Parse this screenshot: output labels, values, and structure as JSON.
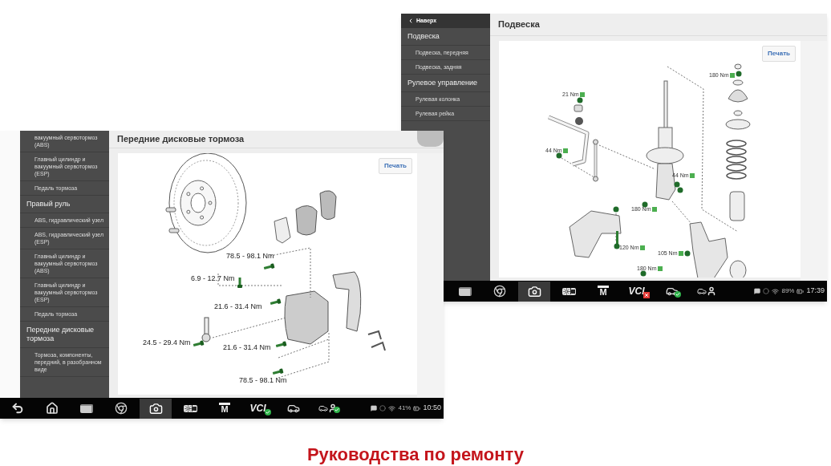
{
  "screens": [
    {
      "sidebar": {
        "header": "Наверх",
        "items": [
          {
            "kind": "group",
            "label": "Подвеска"
          },
          {
            "kind": "item",
            "label": "Подвеска, передняя"
          },
          {
            "kind": "item",
            "label": "Подвеска, задняя"
          },
          {
            "kind": "group",
            "label": "Рулевое управление"
          },
          {
            "kind": "item",
            "label": "Рулевая колонка"
          },
          {
            "kind": "item",
            "label": "Рулевая рейка"
          }
        ]
      },
      "title": "Подвеска",
      "print_button": "Печать",
      "diagram": {
        "kind": "suspension",
        "labels": [
          "180 Nm",
          "21 Nm",
          "44 Nm",
          "44 Nm",
          "180 Nm",
          "120 Nm",
          "105 Nm",
          "180 Nm"
        ]
      },
      "taskbar": {
        "items": [
          {
            "kind": "recents",
            "selected": false,
            "checked": false,
            "error": false
          },
          {
            "kind": "browser",
            "selected": false,
            "checked": false,
            "error": false
          },
          {
            "kind": "camera",
            "selected": true,
            "checked": false,
            "error": false
          },
          {
            "kind": "display",
            "selected": false,
            "checked": false,
            "error": false
          },
          {
            "kind": "manual",
            "text": "M",
            "selected": false,
            "checked": false,
            "error": false
          },
          {
            "kind": "vci",
            "text": "VCI",
            "selected": false,
            "checked": false,
            "error": true
          },
          {
            "kind": "car",
            "selected": false,
            "checked": true,
            "error": false
          },
          {
            "kind": "person",
            "selected": false,
            "checked": false,
            "error": false
          }
        ],
        "battery": "89%",
        "time": "17:39"
      }
    },
    {
      "sidebar": {
        "items": [
          {
            "kind": "item",
            "label": "вакуумный сервотормоз (ABS)"
          },
          {
            "kind": "item",
            "label": "Главный цилиндр и вакуумный сервотормоз (ESP)"
          },
          {
            "kind": "item",
            "label": "Педаль тормоза"
          },
          {
            "kind": "group",
            "label": "Правый руль"
          },
          {
            "kind": "item",
            "label": "ABS, гидравлический узел"
          },
          {
            "kind": "item",
            "label": "ABS, гидравлический узел (ESP)"
          },
          {
            "kind": "item",
            "label": "Главный цилиндр и вакуумный сервотормоз (ABS)"
          },
          {
            "kind": "item",
            "label": "Главный цилиндр и вакуумный сервотормоз (ESP)"
          },
          {
            "kind": "item",
            "label": "Педаль тормоза"
          },
          {
            "kind": "group",
            "label": "Передние дисковые тормоза"
          },
          {
            "kind": "item",
            "label": "Тормоза, компоненты, передний, в разобранном виде"
          }
        ]
      },
      "title": "Передние дисковые тормоза",
      "print_button": "Печать",
      "diagram": {
        "kind": "brakes",
        "labels": [
          "78.5 - 98.1 Nm",
          "6.9 - 12.7 Nm",
          "21.6 - 31.4 Nm",
          "24.5 - 29.4 Nm",
          "21.6 - 31.4 Nm",
          "78.5 - 98.1 Nm"
        ]
      },
      "taskbar": {
        "items": [
          {
            "kind": "back",
            "selected": false,
            "checked": false,
            "error": false
          },
          {
            "kind": "home",
            "selected": false,
            "checked": false,
            "error": false
          },
          {
            "kind": "recents",
            "selected": false,
            "checked": false,
            "error": false
          },
          {
            "kind": "browser",
            "selected": false,
            "checked": false,
            "error": false
          },
          {
            "kind": "camera",
            "selected": true,
            "checked": false,
            "error": false
          },
          {
            "kind": "display",
            "selected": false,
            "checked": false,
            "error": false
          },
          {
            "kind": "manual",
            "text": "M",
            "selected": false,
            "checked": false,
            "error": false
          },
          {
            "kind": "vci",
            "text": "VCI",
            "selected": false,
            "checked": true,
            "error": false
          },
          {
            "kind": "car",
            "selected": false,
            "checked": false,
            "error": false
          },
          {
            "kind": "person",
            "selected": false,
            "checked": true,
            "error": false
          }
        ],
        "battery": "41%",
        "time": "10:50"
      }
    }
  ],
  "caption": "Руководства по ремонту"
}
